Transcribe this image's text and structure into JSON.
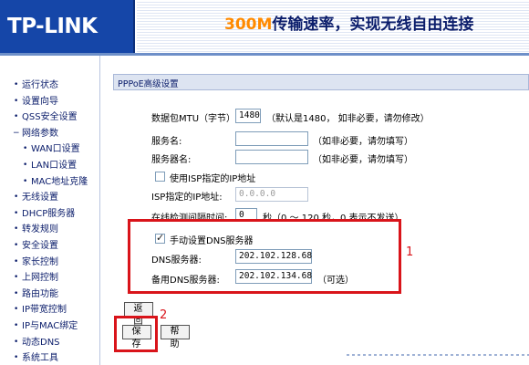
{
  "header": {
    "logo": "TP-LINK",
    "banner_highlight": "300M",
    "banner_text": "传输速率，实现无线自由连接"
  },
  "sidebar": {
    "items": [
      {
        "label": "运行状态",
        "sub": false
      },
      {
        "label": "设置向导",
        "sub": false
      },
      {
        "label": "QSS安全设置",
        "sub": false
      },
      {
        "label": "网络参数",
        "sub": false,
        "active": true
      },
      {
        "label": "WAN口设置",
        "sub": true
      },
      {
        "label": "LAN口设置",
        "sub": true
      },
      {
        "label": "MAC地址克隆",
        "sub": true
      },
      {
        "label": "无线设置",
        "sub": false
      },
      {
        "label": "DHCP服务器",
        "sub": false
      },
      {
        "label": "转发规则",
        "sub": false
      },
      {
        "label": "安全设置",
        "sub": false
      },
      {
        "label": "家长控制",
        "sub": false
      },
      {
        "label": "上网控制",
        "sub": false
      },
      {
        "label": "路由功能",
        "sub": false
      },
      {
        "label": "IP带宽控制",
        "sub": false
      },
      {
        "label": "IP与MAC绑定",
        "sub": false
      },
      {
        "label": "动态DNS",
        "sub": false
      },
      {
        "label": "系统工具",
        "sub": false
      }
    ]
  },
  "panel": {
    "title": "PPPoE高级设置",
    "mtu": {
      "label": "数据包MTU（字节）:",
      "value": "1480",
      "hint": "（默认是1480，  如非必要，请勿修改）"
    },
    "service_name": {
      "label": "服务名:",
      "value": "",
      "hint": "（如非必要，请勿填写）"
    },
    "server_name": {
      "label": "服务器名:",
      "value": "",
      "hint": "（如非必要，请勿填写）"
    },
    "use_isp_ip": {
      "label": "使用ISP指定的IP地址",
      "checked": false
    },
    "isp_ip": {
      "label": "ISP指定的IP地址:",
      "placeholder": "0.0.0.0"
    },
    "online_check": {
      "label": "在线检测间隔时间:",
      "value": "0",
      "hint": "秒（0 ～ 120 秒，0 表示不发送）"
    },
    "manual_dns": {
      "label": "手动设置DNS服务器",
      "checked": true
    },
    "dns_primary": {
      "label": "DNS服务器:",
      "value": "202.102.128.68"
    },
    "dns_secondary": {
      "label": "备用DNS服务器:",
      "value": "202.102.134.68",
      "hint": "（可选）"
    },
    "back_button": "返回",
    "save_button": "保存",
    "help_button": "帮助"
  },
  "annotations": {
    "marker_1": "1",
    "marker_2": "2",
    "color": "#d9141a"
  }
}
